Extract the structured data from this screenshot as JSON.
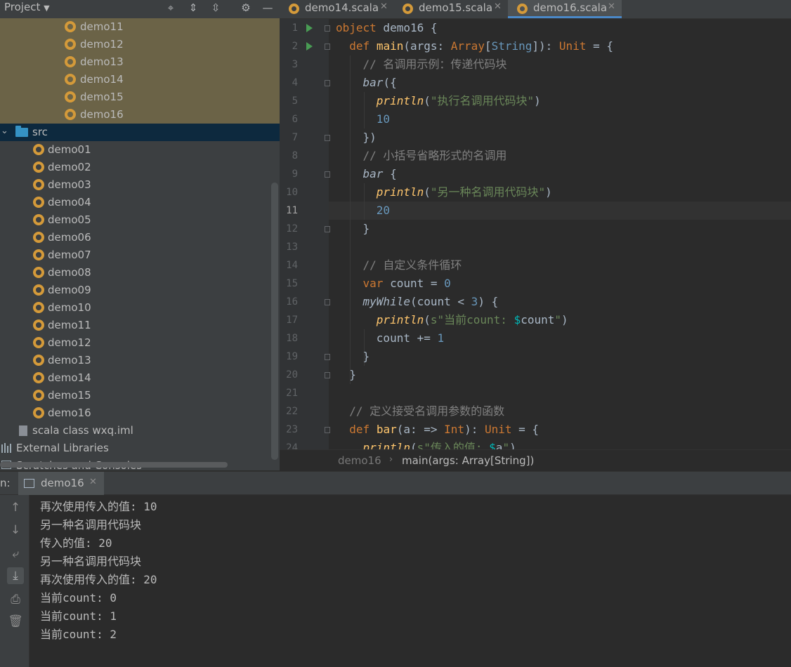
{
  "project_panel": {
    "title": "Project",
    "header_icons": [
      "crosshair-icon",
      "expand-all-icon",
      "collapse-all-icon",
      "gear-icon",
      "minimize-icon"
    ],
    "highlighted_items": [
      "demo11",
      "demo12",
      "demo13",
      "demo14",
      "demo15",
      "demo16"
    ],
    "src_folder": "src",
    "src_items": [
      "demo01",
      "demo02",
      "demo03",
      "demo04",
      "demo05",
      "demo06",
      "demo07",
      "demo08",
      "demo09",
      "demo10",
      "demo11",
      "demo12",
      "demo13",
      "demo14",
      "demo15",
      "demo16"
    ],
    "iml_file": "scala class wxq.iml",
    "external_libraries": "External Libraries",
    "scratches": "Scratches and Consoles"
  },
  "tabs": [
    {
      "label": "demo14.scala",
      "active": false
    },
    {
      "label": "demo15.scala",
      "active": false
    },
    {
      "label": "demo16.scala",
      "active": true
    }
  ],
  "editor": {
    "line_numbers": [
      "1",
      "2",
      "3",
      "4",
      "5",
      "6",
      "7",
      "8",
      "9",
      "10",
      "11",
      "12",
      "13",
      "14",
      "15",
      "16",
      "17",
      "18",
      "19",
      "20",
      "21",
      "22",
      "23",
      "24"
    ],
    "current_line": "11"
  },
  "breadcrumb": {
    "object": "demo16",
    "method": "main(args: Array[String])"
  },
  "run_panel": {
    "prefix": "n:",
    "tab_label": "demo16",
    "output": [
      "再次使用传入的值: 10",
      "另一种名调用代码块",
      "传入的值: 20",
      "另一种名调用代码块",
      "再次使用传入的值: 20",
      "当前count: 0",
      "当前count: 1",
      "当前count: 2"
    ]
  },
  "colors": {
    "keyword": "#cc7832",
    "function": "#ffc66d",
    "string": "#6a8759",
    "number": "#6897bb",
    "comment": "#808080",
    "selection": "#0d293e",
    "highlight": "#6b6347"
  }
}
